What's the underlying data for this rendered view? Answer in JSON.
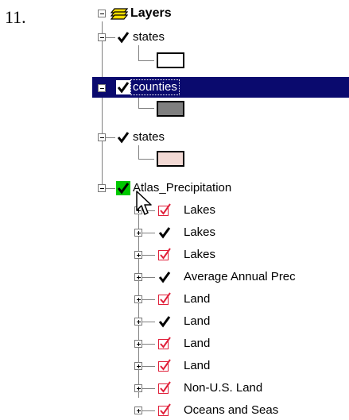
{
  "step_number": "11.",
  "colors": {
    "selection_bg": "#0a0a6e",
    "selection_text": "#ffffff",
    "active_checkbox_bg": "#00c800",
    "check_black": "#000000",
    "check_red": "#e0203a"
  },
  "root": {
    "label": "Layers",
    "icon": "layers-icon",
    "expander": "minus"
  },
  "layers": [
    {
      "label": "states",
      "checked": true,
      "expanded": true,
      "selected": false,
      "swatch_color": "#ffffff"
    },
    {
      "label": "counties",
      "checked": true,
      "expanded": true,
      "selected": true,
      "swatch_color": "#7f7f7f"
    },
    {
      "label": "states",
      "checked": true,
      "expanded": true,
      "selected": false,
      "swatch_color": "#f2d9d4"
    },
    {
      "label": "Atlas_Precipitation",
      "checked": true,
      "expanded": true,
      "selected": false,
      "active": true
    }
  ],
  "sublayers": [
    {
      "label": "Lakes",
      "check_style": "red"
    },
    {
      "label": "Lakes",
      "check_style": "black"
    },
    {
      "label": "Lakes",
      "check_style": "red"
    },
    {
      "label": "Average Annual Prec",
      "check_style": "black"
    },
    {
      "label": "Land",
      "check_style": "red"
    },
    {
      "label": "Land",
      "check_style": "black"
    },
    {
      "label": "Land",
      "check_style": "red"
    },
    {
      "label": "Land",
      "check_style": "red"
    },
    {
      "label": "Non-U.S. Land",
      "check_style": "red"
    },
    {
      "label": "Oceans and Seas",
      "check_style": "red"
    }
  ],
  "cursor": "arrow-pointer-icon"
}
